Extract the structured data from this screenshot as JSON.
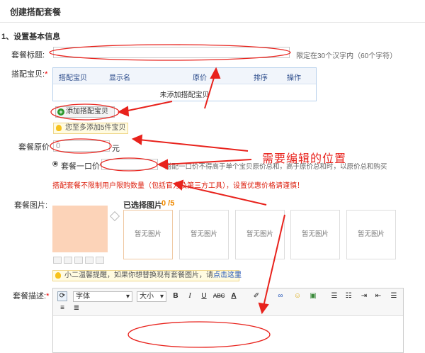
{
  "page": {
    "title": "创建搭配套餐",
    "section1": "1、设置基本信息"
  },
  "form": {
    "package_title_label": "套餐标题:",
    "package_title_value": "",
    "package_title_hint": "限定在30个汉字内（60个字符）",
    "items_label": "搭配宝贝:",
    "items_table": {
      "headers": [
        "搭配宝贝",
        "显示名",
        "原价",
        "排序",
        "操作"
      ],
      "empty_text": "未添加搭配宝贝"
    },
    "add_item_button": "添加搭配宝贝",
    "add_item_tip": "您至多添加5件宝贝",
    "original_price_label": "套餐原价",
    "original_price_value": "0",
    "original_price_unit": "元",
    "fixed_price_option": "套餐一口价",
    "fixed_price_value": "",
    "fixed_price_hint": "搭配一口价不得高于单个宝贝原价总和，高于原价总和时，以原价总和购买",
    "warning": "搭配套餐不限制用户限购数量（包括官方及第三方工具），设置优惠价格请谨慎！",
    "images_label": "套餐图片:",
    "selected_images_label": "已选择图片",
    "selected_images_count": "0 /5",
    "image_placeholder": "暂无图片",
    "image_tip": "小二温馨提醒，如果你想替换现有套餐图片，请",
    "image_tip_link": "点击这里",
    "description_label": "套餐描述:",
    "editor": {
      "font_select": "字体",
      "size_select": "大小",
      "buttons": [
        "B",
        "I",
        "U",
        "ABC",
        "A",
        "✐",
        "∞",
        "☺",
        "▣",
        "☰",
        "☷",
        "⇥",
        "⇤",
        "☰",
        "≡",
        "≣"
      ]
    }
  },
  "annotations": {
    "callout": "需要编辑的位置"
  },
  "colors": {
    "annotation_red": "#e8221c",
    "callout_red": "#e8221c",
    "table_border": "#b9d1ec",
    "preview_fill": "#fcd3b8",
    "warning_red": "#d21111"
  }
}
